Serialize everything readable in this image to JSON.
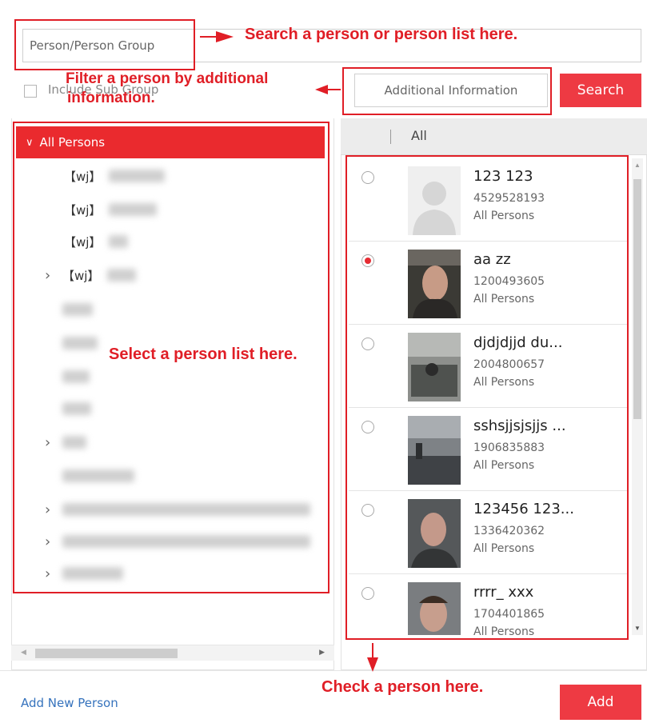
{
  "search": {
    "person_placeholder": "Person/Person Group",
    "include_sub_group_label": "Include Sub Group",
    "additional_placeholder": "Additional Information",
    "search_button": "Search"
  },
  "tree": {
    "root_label": "All Persons",
    "items": [
      {
        "label": "【wj】",
        "expandable": false
      },
      {
        "label": "【wj】",
        "expandable": false
      },
      {
        "label": "【wj】",
        "expandable": false
      },
      {
        "label": "【wj】",
        "expandable": true
      }
    ]
  },
  "list": {
    "header_label": "All",
    "persons": [
      {
        "name": "123 123",
        "id": "4529528193",
        "group": "All Persons",
        "selected": false
      },
      {
        "name": "aa zz",
        "id": "1200493605",
        "group": "All Persons",
        "selected": true
      },
      {
        "name": "djdjdjjd du...",
        "id": "2004800657",
        "group": "All Persons",
        "selected": false
      },
      {
        "name": "sshsjjsjsjjs ...",
        "id": "1906835883",
        "group": "All Persons",
        "selected": false
      },
      {
        "name": "123456 123...",
        "id": "1336420362",
        "group": "All Persons",
        "selected": false
      },
      {
        "name": "rrrr_ xxx",
        "id": "1704401865",
        "group": "All Persons",
        "selected": false
      }
    ]
  },
  "footer": {
    "add_new_person_link": "Add New Person",
    "add_button": "Add"
  },
  "annotations": {
    "search_tip": "Search a person or person list here.",
    "filter_tip_line1": "Filter a person by additional",
    "filter_tip_line2": "information.",
    "tree_tip": "Select a person list here.",
    "check_tip": "Check a person here."
  },
  "colors": {
    "accent_red": "#ee3a43",
    "annotation_red": "#e01e26",
    "link_blue": "#3673bd"
  }
}
